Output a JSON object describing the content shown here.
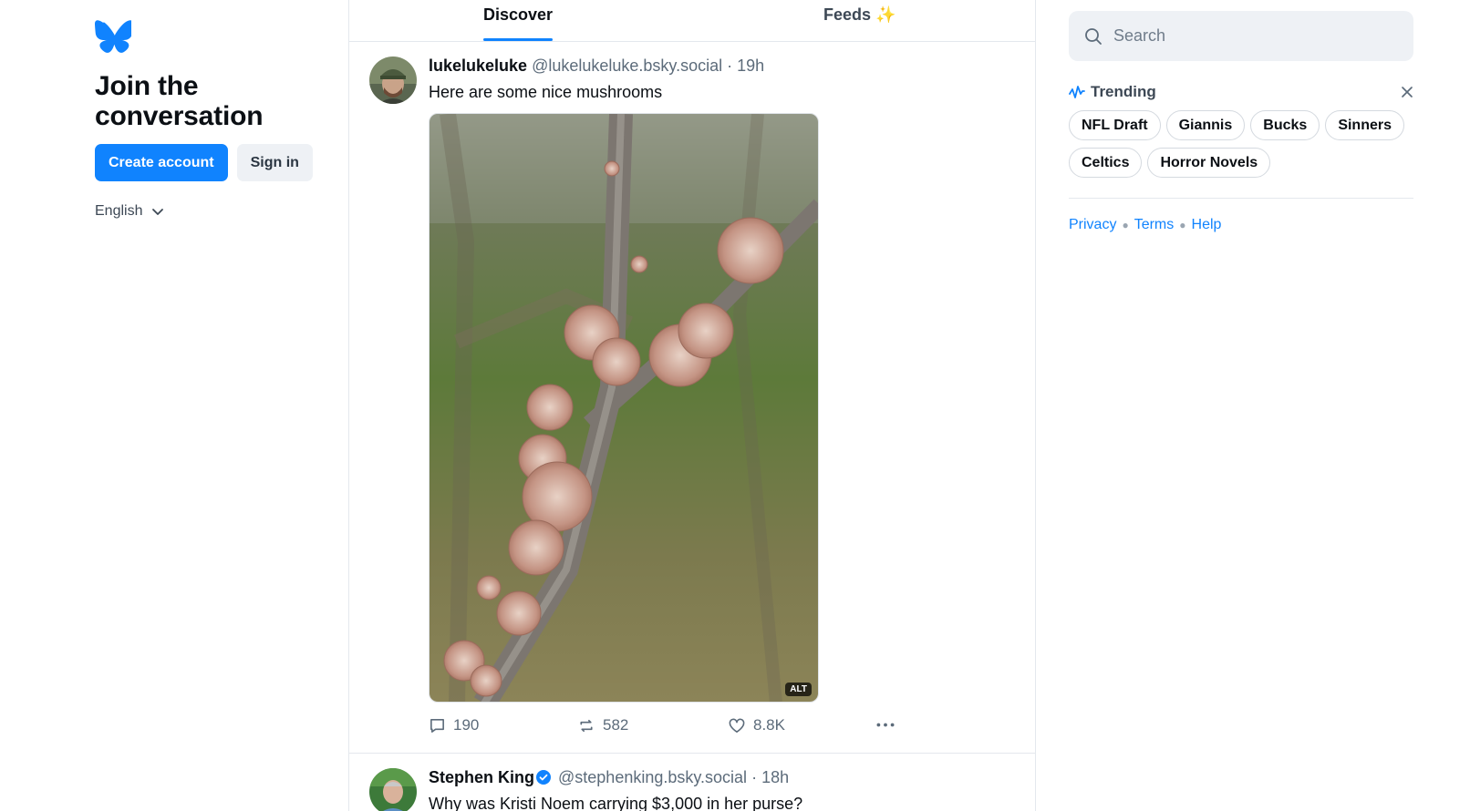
{
  "left": {
    "logo_icon": "butterfly-icon",
    "title": "Join the conversation",
    "create_account_label": "Create account",
    "sign_in_label": "Sign in",
    "language": "English"
  },
  "tabs": [
    {
      "label": "Discover",
      "active": true
    },
    {
      "label": "Feeds ✨",
      "active": false
    }
  ],
  "posts": [
    {
      "display_name": "lukelukeluke",
      "handle": "@lukelukeluke.bsky.social",
      "time": "· 19h",
      "text": "Here are some nice mushrooms",
      "image_alt_badge": "ALT",
      "replies": "190",
      "reposts": "582",
      "likes": "8.8K"
    },
    {
      "display_name": "Stephen King",
      "handle": "@stephenking.bsky.social",
      "time": "· 18h",
      "text": "Why was Kristi Noem carrying $3,000 in her purse?",
      "verified": true
    }
  ],
  "search": {
    "placeholder": "Search"
  },
  "trending": {
    "title": "Trending",
    "topics": [
      "NFL Draft",
      "Giannis",
      "Bucks",
      "Sinners",
      "Celtics",
      "Horror Novels"
    ]
  },
  "footer": {
    "privacy": "Privacy",
    "terms": "Terms",
    "help": "Help"
  },
  "colors": {
    "accent": "#1083fe",
    "text": "#0b0f14",
    "muted": "#5c6b7a",
    "border": "#e4e8ed"
  }
}
